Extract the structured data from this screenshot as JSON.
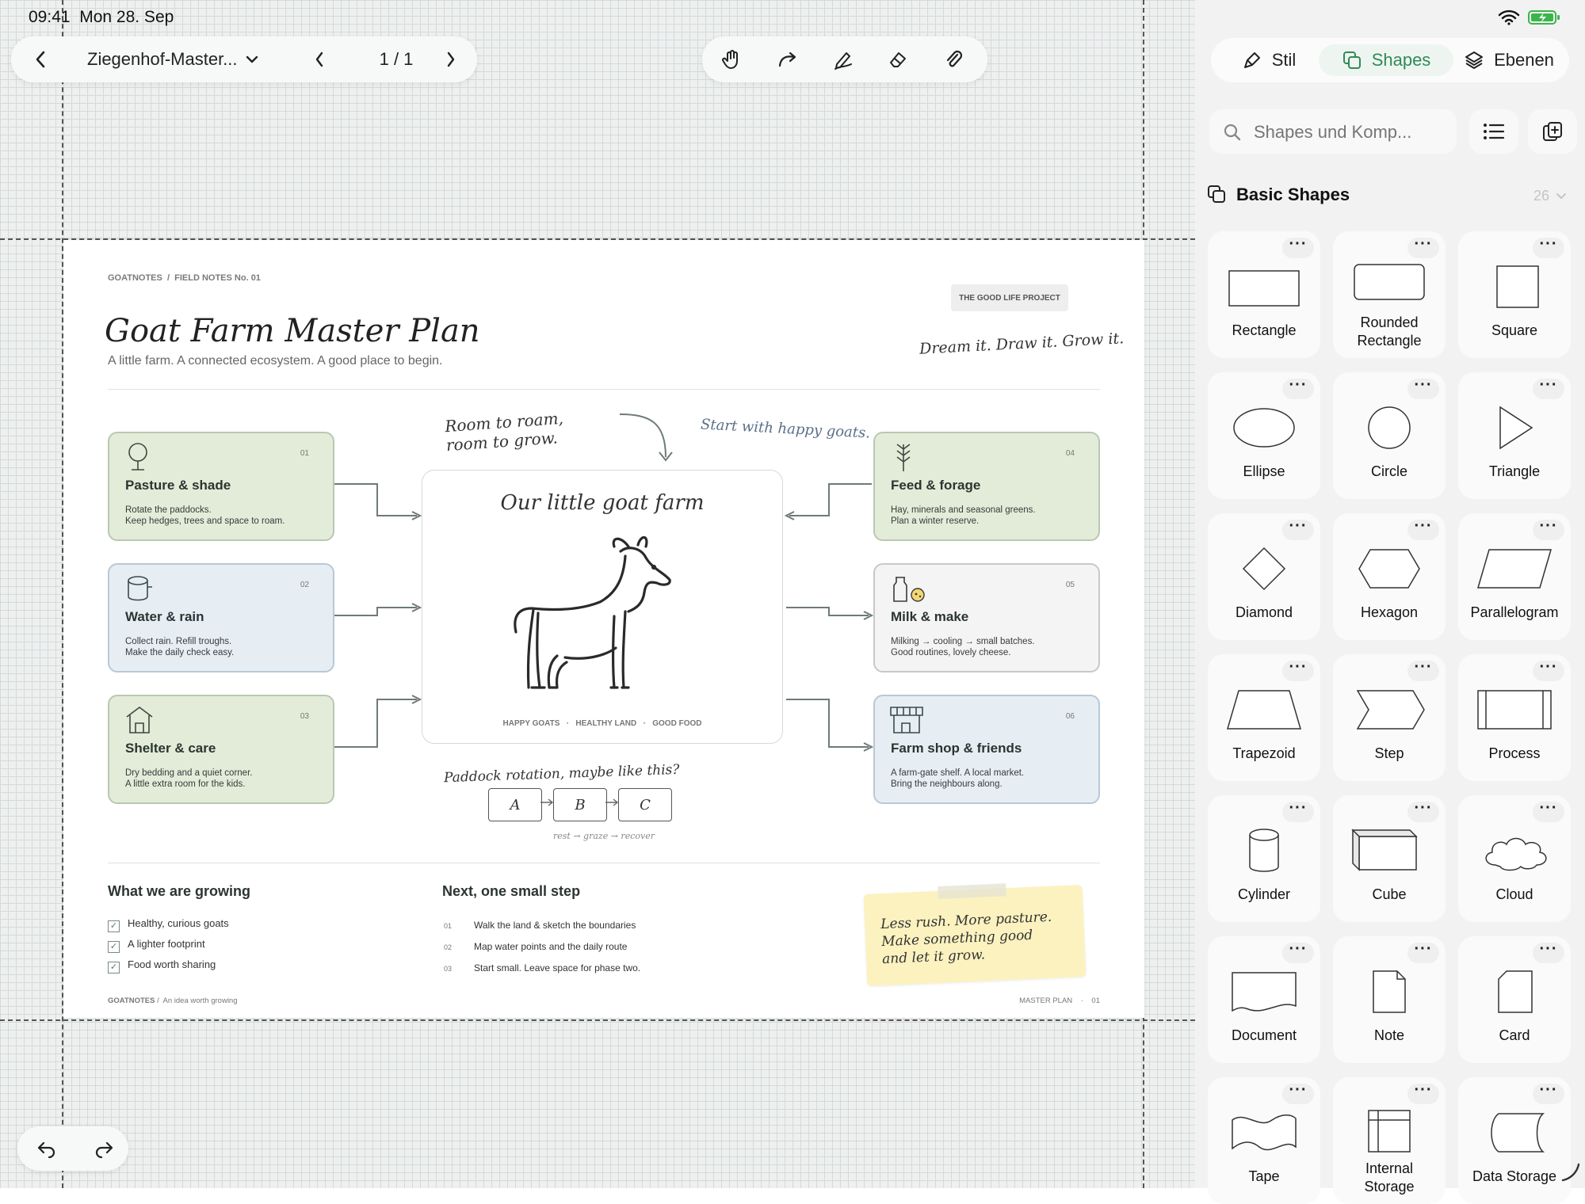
{
  "status_bar": {
    "time_date": "09:41  Mon 28. Sep"
  },
  "toolbar": {
    "document_title": "Ziegenhof-Master...",
    "page_indicator": "1 / 1"
  },
  "page": {
    "breadcrumb": "GOATNOTES  /  FIELD NOTES No. 01",
    "project_tag": "THE GOOD LIFE PROJECT",
    "title": "Goat Farm Master Plan",
    "subtitle": "A little farm. A connected ecosystem. A good place to begin.",
    "tagline": "Dream it. Draw it. Grow it.",
    "note_roam": "Room to roam,\nroom to grow.",
    "note_happy": "Start with happy goats.",
    "center_title": "Our little goat farm",
    "center_footer": "HAPPY GOATS   ·   HEALTHY LAND   ·   GOOD FOOD",
    "cards": [
      {
        "num": "01",
        "title": "Pasture & shade",
        "desc": "Rotate the paddocks.\nKeep hedges, trees and space to roam."
      },
      {
        "num": "02",
        "title": "Water & rain",
        "desc": "Collect rain. Refill troughs.\nMake the daily check easy."
      },
      {
        "num": "03",
        "title": "Shelter & care",
        "desc": "Dry bedding and a quiet corner.\nA little extra room for the kids."
      },
      {
        "num": "04",
        "title": "Feed & forage",
        "desc": "Hay, minerals and seasonal greens.\nPlan a winter reserve."
      },
      {
        "num": "05",
        "title": "Milk & make",
        "desc": "Milking → cooling → small batches.\nGood routines, lovely cheese."
      },
      {
        "num": "06",
        "title": "Farm shop & friends",
        "desc": "A farm-gate shelf. A local market.\nBring the neighbours along."
      }
    ],
    "rotation": {
      "title": "Paddock rotation, maybe like this?",
      "boxes": [
        "A",
        "B",
        "C"
      ],
      "caption": "rest → graze → recover"
    },
    "growing": {
      "heading": "What we are growing",
      "items": [
        "Healthy, curious goats",
        "A lighter footprint",
        "Food worth sharing"
      ]
    },
    "next_step": {
      "heading": "Next, one small step",
      "items": [
        {
          "num": "01",
          "text": "Walk the land & sketch the boundaries"
        },
        {
          "num": "02",
          "text": "Map water points and the daily route"
        },
        {
          "num": "03",
          "text": "Start small. Leave space for phase two."
        }
      ]
    },
    "sticky_note": "Less rush. More pasture.\nMake something good\nand let it grow.",
    "footer_left_brand": "GOATNOTES",
    "footer_left_text": "/  An idea worth growing",
    "footer_right": "MASTER PLAN    ·    01"
  },
  "panel": {
    "tabs": [
      {
        "label": "Stil",
        "icon": "brush-icon"
      },
      {
        "label": "Shapes",
        "icon": "shapes-icon",
        "active": true
      },
      {
        "label": "Ebenen",
        "icon": "layers-icon"
      }
    ],
    "search_placeholder": "Shapes und Komp...",
    "section_title": "Basic Shapes",
    "section_count": "26",
    "accent_color": "#2e8b57",
    "shapes": [
      "Rectangle",
      "Rounded\nRectangle",
      "Square",
      "Ellipse",
      "Circle",
      "Triangle",
      "Diamond",
      "Hexagon",
      "Parallelogram",
      "Trapezoid",
      "Step",
      "Process",
      "Cylinder",
      "Cube",
      "Cloud",
      "Document",
      "Note",
      "Card",
      "Tape",
      "Internal\nStorage",
      "Data Storage"
    ]
  }
}
